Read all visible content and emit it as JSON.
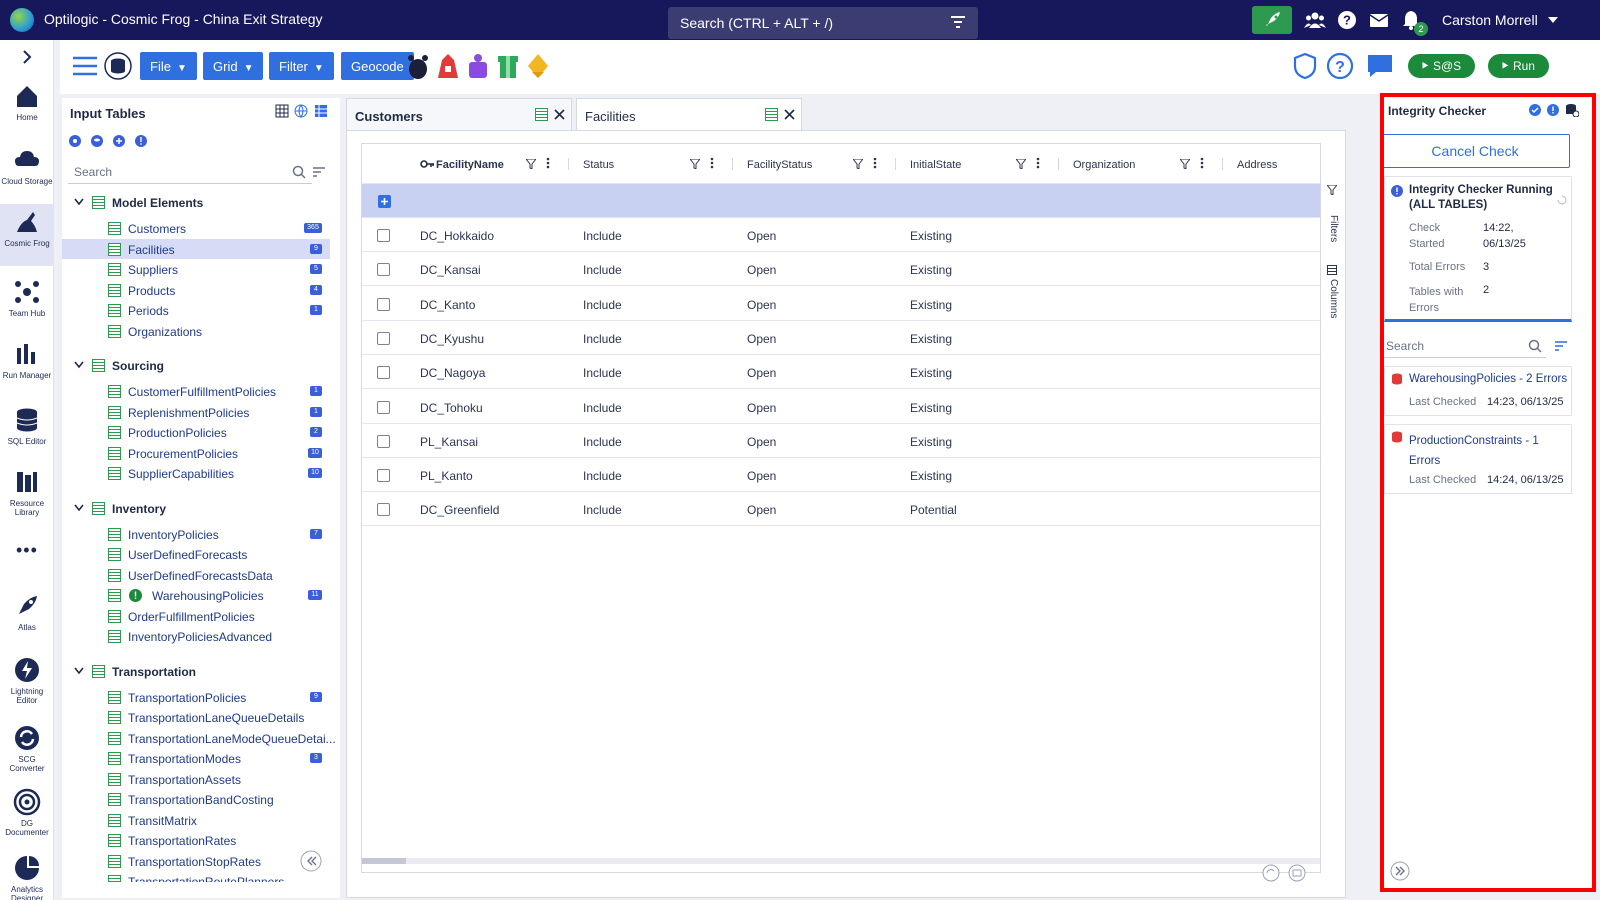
{
  "app": {
    "title": "Optilogic - Cosmic Frog - China Exit Strategy",
    "search_placeholder": "Search (CTRL + ALT + /)",
    "user_name": "Carston Morrell",
    "notification_count": "2"
  },
  "toolbar": {
    "file_label": "File",
    "grid_label": "Grid",
    "filter_label": "Filter",
    "geocode_label": "Geocode",
    "sas_label": "S@S",
    "run_label": "Run"
  },
  "leftnav": {
    "items": [
      {
        "label": "Home"
      },
      {
        "label": "Cloud Storage"
      },
      {
        "label": "Cosmic Frog"
      },
      {
        "label": "Team Hub"
      },
      {
        "label": "Run Manager"
      },
      {
        "label": "SQL Editor"
      },
      {
        "label": "Resource Library"
      },
      {
        "label": "Atlas"
      },
      {
        "label": "Lightning Editor"
      },
      {
        "label": "SCG Converter"
      },
      {
        "label": "DG Documenter"
      },
      {
        "label": "Analytics Designer"
      }
    ]
  },
  "input_tables": {
    "title": "Input Tables",
    "search_placeholder": "Search",
    "groups": [
      {
        "name": "Model Elements",
        "items": [
          {
            "name": "Customers",
            "badge": "365"
          },
          {
            "name": "Facilities",
            "badge": "9"
          },
          {
            "name": "Suppliers",
            "badge": "5"
          },
          {
            "name": "Products",
            "badge": "4"
          },
          {
            "name": "Periods",
            "badge": "1"
          },
          {
            "name": "Organizations",
            "badge": ""
          }
        ]
      },
      {
        "name": "Sourcing",
        "items": [
          {
            "name": "CustomerFulfillmentPolicies",
            "badge": "1"
          },
          {
            "name": "ReplenishmentPolicies",
            "badge": "1"
          },
          {
            "name": "ProductionPolicies",
            "badge": "2"
          },
          {
            "name": "ProcurementPolicies",
            "badge": "10"
          },
          {
            "name": "SupplierCapabilities",
            "badge": "10"
          }
        ]
      },
      {
        "name": "Inventory",
        "items": [
          {
            "name": "InventoryPolicies",
            "badge": "7"
          },
          {
            "name": "UserDefinedForecasts",
            "badge": ""
          },
          {
            "name": "UserDefinedForecastsData",
            "badge": ""
          },
          {
            "name": "WarehousingPolicies",
            "badge": "11"
          },
          {
            "name": "OrderFulfillmentPolicies",
            "badge": ""
          },
          {
            "name": "InventoryPoliciesAdvanced",
            "badge": ""
          }
        ]
      },
      {
        "name": "Transportation",
        "items": [
          {
            "name": "TransportationPolicies",
            "badge": "9"
          },
          {
            "name": "TransportationLaneQueueDetails",
            "badge": ""
          },
          {
            "name": "TransportationLaneModeQueueDetai...",
            "badge": ""
          },
          {
            "name": "TransportationModes",
            "badge": "3"
          },
          {
            "name": "TransportationAssets",
            "badge": ""
          },
          {
            "name": "TransportationBandCosting",
            "badge": ""
          },
          {
            "name": "TransitMatrix",
            "badge": ""
          },
          {
            "name": "TransportationRates",
            "badge": ""
          },
          {
            "name": "TransportationStopRates",
            "badge": ""
          },
          {
            "name": "TransportationRoutePlanners",
            "badge": ""
          }
        ]
      }
    ]
  },
  "tabs": [
    {
      "label": "Customers"
    },
    {
      "label": "Facilities"
    }
  ],
  "grid": {
    "columns": [
      "FacilityName",
      "Status",
      "FacilityStatus",
      "InitialState",
      "Organization",
      "Address"
    ],
    "rows": [
      [
        "DC_Hokkaido",
        "Include",
        "Open",
        "Existing"
      ],
      [
        "DC_Kansai",
        "Include",
        "Open",
        "Existing"
      ],
      [
        "DC_Kanto",
        "Include",
        "Open",
        "Existing"
      ],
      [
        "DC_Kyushu",
        "Include",
        "Open",
        "Existing"
      ],
      [
        "DC_Nagoya",
        "Include",
        "Open",
        "Existing"
      ],
      [
        "DC_Tohoku",
        "Include",
        "Open",
        "Existing"
      ],
      [
        "PL_Kansai",
        "Include",
        "Open",
        "Existing"
      ],
      [
        "PL_Kanto",
        "Include",
        "Open",
        "Existing"
      ],
      [
        "DC_Greenfield",
        "Include",
        "Open",
        "Potential"
      ]
    ],
    "side_filters_label": "Filters",
    "side_columns_label": "Columns"
  },
  "integrity": {
    "title": "Integrity Checker",
    "cancel_label": "Cancel Check",
    "running_title": "Integrity Checker Running (ALL TABLES)",
    "check_started_label": "Check Started",
    "check_started_value": "14:22, 06/13/25",
    "total_errors_label": "Total Errors",
    "total_errors_value": "3",
    "tables_with_errors_label": "Tables with Errors",
    "tables_with_errors_value": "2",
    "search_placeholder": "Search",
    "results": [
      {
        "table": "WarehousingPolicies - 2 Errors",
        "last_checked_label": "Last Checked",
        "last_checked": "14:23, 06/13/25"
      },
      {
        "table": "ProductionConstraints - 1 Errors",
        "last_checked_label": "Last Checked",
        "last_checked": "14:24, 06/13/25"
      }
    ]
  },
  "colors": {
    "topbar": "#17185b",
    "accent_blue": "#2f6fe0",
    "accent_green": "#1b8a3a",
    "highlight_red": "#ff0000"
  }
}
